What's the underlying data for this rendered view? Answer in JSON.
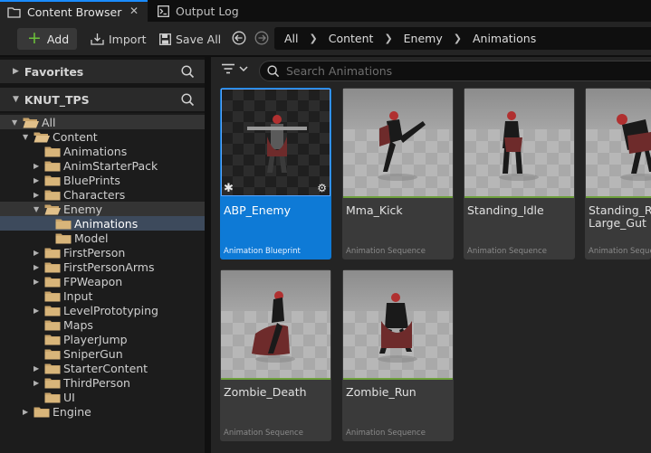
{
  "tabs": [
    {
      "label": "Content Browser",
      "icon": "content-browser-icon",
      "close": "✕"
    },
    {
      "label": "Output Log",
      "icon": "output-log-icon"
    }
  ],
  "toolbar": {
    "add_label": "Add",
    "import_label": "Import",
    "saveall_label": "Save All"
  },
  "breadcrumbs": [
    "All",
    "Content",
    "Enemy",
    "Animations"
  ],
  "left": {
    "favorites": "Favorites",
    "project": "KNUT_TPS",
    "tree": [
      {
        "label": "All"
      },
      {
        "label": "Content"
      },
      {
        "label": "Animations"
      },
      {
        "label": "AnimStarterPack"
      },
      {
        "label": "BluePrints"
      },
      {
        "label": "Characters"
      },
      {
        "label": "Enemy"
      },
      {
        "label": "Animations"
      },
      {
        "label": "Model"
      },
      {
        "label": "FirstPerson"
      },
      {
        "label": "FirstPersonArms"
      },
      {
        "label": "FPWeapon"
      },
      {
        "label": "Input"
      },
      {
        "label": "LevelPrototyping"
      },
      {
        "label": "Maps"
      },
      {
        "label": "PlayerJump"
      },
      {
        "label": "SniperGun"
      },
      {
        "label": "StarterContent"
      },
      {
        "label": "ThirdPerson"
      },
      {
        "label": "UI"
      },
      {
        "label": "Engine"
      }
    ]
  },
  "search": {
    "placeholder": "Search Animations"
  },
  "assets": [
    {
      "name": "ABP_Enemy",
      "type": "Animation Blueprint"
    },
    {
      "name": "Mma_Kick",
      "type": "Animation Sequence"
    },
    {
      "name": "Standing_Idle",
      "type": "Animation Sequence"
    },
    {
      "name": "Standing_React_Large_Gut",
      "display": "Standing_Re\nLarge_Gut",
      "type": "Animation Sequence"
    },
    {
      "name": "Zombie_Death",
      "type": "Animation Sequence"
    },
    {
      "name": "Zombie_Run",
      "type": "Animation Sequence"
    }
  ],
  "colors": {
    "accent": "#0e7ad6",
    "add_plus": "#6bbf3a",
    "anim_bar": "#6ea03c",
    "tree_highlight": "#3d4a5c"
  }
}
